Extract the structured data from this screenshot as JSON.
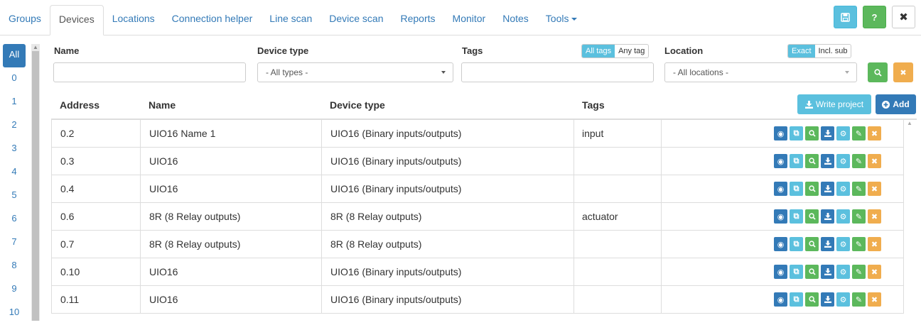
{
  "nav": {
    "tabs": [
      {
        "label": "Groups"
      },
      {
        "label": "Devices"
      },
      {
        "label": "Locations"
      },
      {
        "label": "Connection helper"
      },
      {
        "label": "Line scan"
      },
      {
        "label": "Device scan"
      },
      {
        "label": "Reports"
      },
      {
        "label": "Monitor"
      },
      {
        "label": "Notes"
      },
      {
        "label": "Tools"
      }
    ],
    "active_tab": "Devices",
    "help_label": "?",
    "close_label": "✖"
  },
  "sidebar": {
    "items": [
      "All",
      "0",
      "1",
      "2",
      "3",
      "4",
      "5",
      "6",
      "7",
      "8",
      "9",
      "10"
    ]
  },
  "filters": {
    "name_label": "Name",
    "name_value": "",
    "device_type_label": "Device type",
    "device_type_value": "- All types -",
    "tags_label": "Tags",
    "tags_value": "",
    "tag_mode_all": "All tags",
    "tag_mode_any": "Any tag",
    "location_label": "Location",
    "location_value": "- All locations -",
    "loc_mode_exact": "Exact",
    "loc_mode_sub": "Incl. sub"
  },
  "table": {
    "headers": {
      "address": "Address",
      "name": "Name",
      "device_type": "Device type",
      "tags": "Tags"
    },
    "write_project_label": "Write project",
    "add_label": "Add",
    "rows": [
      {
        "address": "0.2",
        "name": "UIO16 Name 1",
        "device_type": "UIO16 (Binary inputs/outputs)",
        "tags": "input"
      },
      {
        "address": "0.3",
        "name": "UIO16",
        "device_type": "UIO16 (Binary inputs/outputs)",
        "tags": ""
      },
      {
        "address": "0.4",
        "name": "UIO16",
        "device_type": "UIO16 (Binary inputs/outputs)",
        "tags": ""
      },
      {
        "address": "0.6",
        "name": "8R (8 Relay outputs)",
        "device_type": "8R (8 Relay outputs)",
        "tags": "actuator"
      },
      {
        "address": "0.7",
        "name": "8R (8 Relay outputs)",
        "device_type": "8R (8 Relay outputs)",
        "tags": ""
      },
      {
        "address": "0.10",
        "name": "UIO16",
        "device_type": "UIO16 (Binary inputs/outputs)",
        "tags": ""
      },
      {
        "address": "0.11",
        "name": "UIO16",
        "device_type": "UIO16 (Binary inputs/outputs)",
        "tags": ""
      }
    ]
  },
  "row_action_icons": [
    "target-icon",
    "copy-icon",
    "search-icon",
    "download-icon",
    "gear-icon",
    "pencil-icon",
    "close-icon"
  ],
  "colors": {
    "primary": "#337ab7",
    "info": "#5bc0de",
    "success": "#5cb85c",
    "warning": "#f0ad4e"
  }
}
